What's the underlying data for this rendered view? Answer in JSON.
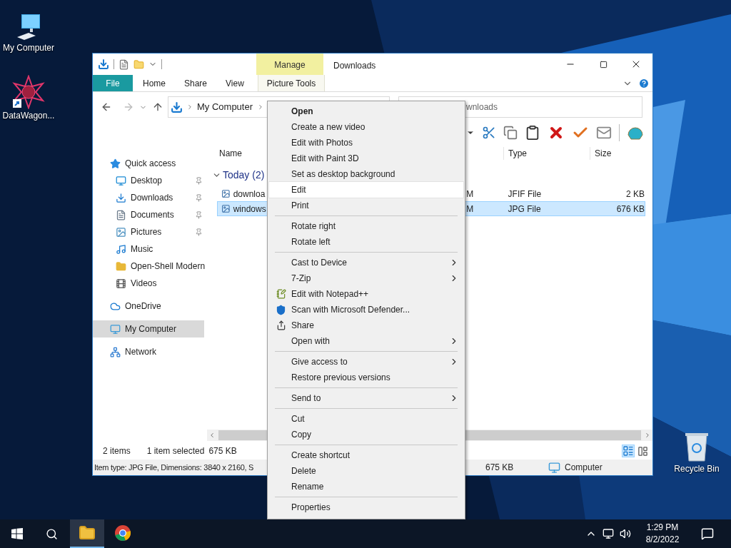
{
  "desktop_icons": [
    {
      "label": "My Computer",
      "kind": "computer"
    },
    {
      "label": "DataWagon...",
      "kind": "shortcut"
    },
    {
      "label": "Recycle Bin",
      "kind": "recycle"
    }
  ],
  "explorer": {
    "context_tab": "Manage",
    "title": "Downloads",
    "tabs": [
      {
        "label": "File",
        "kind": "file",
        "selected": false
      },
      {
        "label": "Home",
        "kind": "tab",
        "selected": false
      },
      {
        "label": "Share",
        "kind": "tab",
        "selected": false
      },
      {
        "label": "View",
        "kind": "tab",
        "selected": false
      },
      {
        "label": "Picture Tools",
        "kind": "context",
        "selected": false
      }
    ],
    "address": {
      "crumbs": [
        "My Computer"
      ]
    },
    "search": {
      "placeholder": "wnloads"
    },
    "nav": [
      {
        "label": "Quick access",
        "kind": "star",
        "selected": false,
        "children": [
          {
            "label": "Desktop",
            "kind": "desktop",
            "selected": false,
            "pinned": true
          },
          {
            "label": "Downloads",
            "kind": "downloads",
            "selected": false,
            "pinned": true
          },
          {
            "label": "Documents",
            "kind": "documents",
            "selected": false,
            "pinned": true
          },
          {
            "label": "Pictures",
            "kind": "pictures",
            "selected": false,
            "pinned": true
          },
          {
            "label": "Music",
            "kind": "music",
            "selected": false,
            "pinned": false
          },
          {
            "label": "Open-Shell Modern",
            "kind": "folder",
            "selected": false,
            "pinned": false
          },
          {
            "label": "Videos",
            "kind": "videos",
            "selected": false,
            "pinned": false
          }
        ]
      },
      {
        "label": "OneDrive",
        "kind": "cloud",
        "selected": false
      },
      {
        "label": "My Computer",
        "kind": "computer",
        "selected": true
      },
      {
        "label": "Network",
        "kind": "network",
        "selected": false
      }
    ],
    "columns": [
      "Name",
      "Type",
      "Size"
    ],
    "group": {
      "label": "Today (2)",
      "expanded": true
    },
    "files": [
      {
        "name": "downloa",
        "date": "M",
        "type": "JFIF File",
        "size": "2 KB",
        "selected": false
      },
      {
        "name": "windows",
        "date": "M",
        "type": "JPG File",
        "size": "676 KB",
        "selected": true
      }
    ],
    "status": {
      "count": "2 items",
      "selection": "1 item selected",
      "size": "675 KB"
    },
    "details": {
      "info": "Item type: JPG File, Dimensions: 3840 x 2160, S",
      "size": "675 KB",
      "location": "Computer"
    }
  },
  "context_menu": [
    {
      "kind": "item",
      "label": "Open",
      "bold": true,
      "selected": false
    },
    {
      "kind": "item",
      "label": "Create a new video",
      "selected": false
    },
    {
      "kind": "item",
      "label": "Edit with Photos",
      "selected": false
    },
    {
      "kind": "item",
      "label": "Edit with Paint 3D",
      "selected": false
    },
    {
      "kind": "item",
      "label": "Set as desktop background",
      "selected": false
    },
    {
      "kind": "item",
      "label": "Edit",
      "selected": true
    },
    {
      "kind": "item",
      "label": "Print",
      "selected": false
    },
    {
      "kind": "separator"
    },
    {
      "kind": "item",
      "label": "Rotate right",
      "selected": false
    },
    {
      "kind": "item",
      "label": "Rotate left",
      "selected": false
    },
    {
      "kind": "separator"
    },
    {
      "kind": "item",
      "label": "Cast to Device",
      "submenu": true,
      "selected": false
    },
    {
      "kind": "item",
      "label": "7-Zip",
      "submenu": true,
      "selected": false
    },
    {
      "kind": "notepad",
      "label": "Edit with Notepad++",
      "selected": false
    },
    {
      "kind": "defender",
      "label": "Scan with Microsoft Defender...",
      "selected": false
    },
    {
      "kind": "share",
      "label": "Share",
      "selected": false
    },
    {
      "kind": "item",
      "label": "Open with",
      "submenu": true,
      "selected": false
    },
    {
      "kind": "separator"
    },
    {
      "kind": "item",
      "label": "Give access to",
      "submenu": true,
      "selected": false
    },
    {
      "kind": "item",
      "label": "Restore previous versions",
      "selected": false
    },
    {
      "kind": "separator"
    },
    {
      "kind": "item",
      "label": "Send to",
      "submenu": true,
      "selected": false
    },
    {
      "kind": "separator"
    },
    {
      "kind": "item",
      "label": "Cut",
      "selected": false
    },
    {
      "kind": "item",
      "label": "Copy",
      "selected": false
    },
    {
      "kind": "separator"
    },
    {
      "kind": "item",
      "label": "Create shortcut",
      "selected": false
    },
    {
      "kind": "item",
      "label": "Delete",
      "selected": false
    },
    {
      "kind": "item",
      "label": "Rename",
      "selected": false
    },
    {
      "kind": "separator"
    },
    {
      "kind": "item",
      "label": "Properties",
      "selected": false
    }
  ],
  "taskbar": {
    "apps": [
      {
        "kind": "explorer",
        "selected": true
      },
      {
        "kind": "chrome",
        "selected": false
      }
    ],
    "time": "1:29 PM",
    "date": "8/2/2022"
  }
}
